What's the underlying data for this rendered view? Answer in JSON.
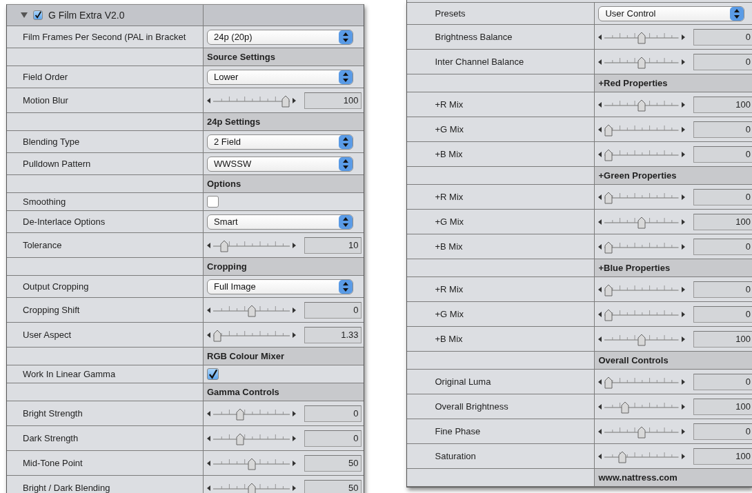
{
  "panels": [
    {
      "header": {
        "title": "G Film Extra V2.0",
        "expanded": true,
        "enabled": true
      },
      "rows": [
        {
          "kind": "popup",
          "label": "Film Frames Per Second (PAL in Bracket",
          "value": "24p (20p)"
        },
        {
          "kind": "section",
          "title": "Source Settings"
        },
        {
          "kind": "popup",
          "label": "Field Order",
          "value": "Lower"
        },
        {
          "kind": "slider",
          "label": "Motion Blur",
          "level": 1,
          "reading": "100"
        },
        {
          "kind": "section",
          "title": "24p Settings"
        },
        {
          "kind": "popup",
          "label": "Blending Type",
          "value": "2 Field"
        },
        {
          "kind": "popup",
          "label": "Pulldown Pattern",
          "value": "WWSSW"
        },
        {
          "kind": "section",
          "title": "Options"
        },
        {
          "kind": "checkbox",
          "label": "Smoothing",
          "checked": false
        },
        {
          "kind": "popup",
          "label": "De-Interlace Options",
          "value": "Smart"
        },
        {
          "kind": "slider",
          "label": "Tolerance",
          "level": 0.1,
          "reading": "10"
        },
        {
          "kind": "section",
          "title": "Cropping"
        },
        {
          "kind": "popup",
          "label": "Output Cropping",
          "value": "Full Image"
        },
        {
          "kind": "slider",
          "label": "Cropping Shift",
          "level": 0.5,
          "reading": "0"
        },
        {
          "kind": "slider",
          "label": "User Aspect",
          "level": 0,
          "reading": "1.33"
        },
        {
          "kind": "section",
          "title": "RGB Colour Mixer"
        },
        {
          "kind": "checkbox",
          "label": "Work In Linear Gamma",
          "checked": true
        },
        {
          "kind": "section",
          "title": "Gamma Controls"
        },
        {
          "kind": "slider",
          "label": "Bright Strength",
          "level": 0.33,
          "reading": "0"
        },
        {
          "kind": "slider",
          "label": "Dark Strength",
          "level": 0.33,
          "reading": "0"
        },
        {
          "kind": "slider",
          "label": "Mid-Tone Point",
          "level": 0.5,
          "reading": "50"
        },
        {
          "kind": "slider",
          "label": "Bright / Dark Blending",
          "level": 0.5,
          "reading": "50"
        }
      ]
    },
    {
      "rows": [
        {
          "kind": "popup",
          "label": "Presets",
          "value": "User Control"
        },
        {
          "kind": "slider",
          "label": "Brightness Balance",
          "level": 0.5,
          "reading": "0"
        },
        {
          "kind": "slider",
          "label": "Inter Channel Balance",
          "level": 0.5,
          "reading": "0"
        },
        {
          "kind": "section",
          "title": "+Red Properties"
        },
        {
          "kind": "slider",
          "label": "+R Mix",
          "level": 0.5,
          "reading": "100"
        },
        {
          "kind": "slider",
          "label": "+G Mix",
          "level": 0,
          "reading": "0"
        },
        {
          "kind": "slider",
          "label": "+B Mix",
          "level": 0,
          "reading": "0"
        },
        {
          "kind": "section",
          "title": "+Green Properties"
        },
        {
          "kind": "slider",
          "label": "+R Mix",
          "level": 0,
          "reading": "0"
        },
        {
          "kind": "slider",
          "label": "+G Mix",
          "level": 0.5,
          "reading": "100"
        },
        {
          "kind": "slider",
          "label": "+B Mix",
          "level": 0,
          "reading": "0"
        },
        {
          "kind": "section",
          "title": "+Blue Properties"
        },
        {
          "kind": "slider",
          "label": "+R Mix",
          "level": 0,
          "reading": "0"
        },
        {
          "kind": "slider",
          "label": "+G Mix",
          "level": 0,
          "reading": "0"
        },
        {
          "kind": "slider",
          "label": "+B Mix",
          "level": 0.5,
          "reading": "100"
        },
        {
          "kind": "section",
          "title": "Overall Controls"
        },
        {
          "kind": "slider",
          "label": "Original Luma",
          "level": 0,
          "reading": "0"
        },
        {
          "kind": "slider",
          "label": "Overall Brightness",
          "level": 0.25,
          "reading": "100"
        },
        {
          "kind": "slider",
          "label": "Fine Phase",
          "level": 0.5,
          "reading": "0"
        },
        {
          "kind": "slider",
          "label": "Saturation",
          "level": 0.2,
          "reading": "100"
        },
        {
          "kind": "section",
          "title": "www.nattress.com"
        }
      ]
    }
  ]
}
